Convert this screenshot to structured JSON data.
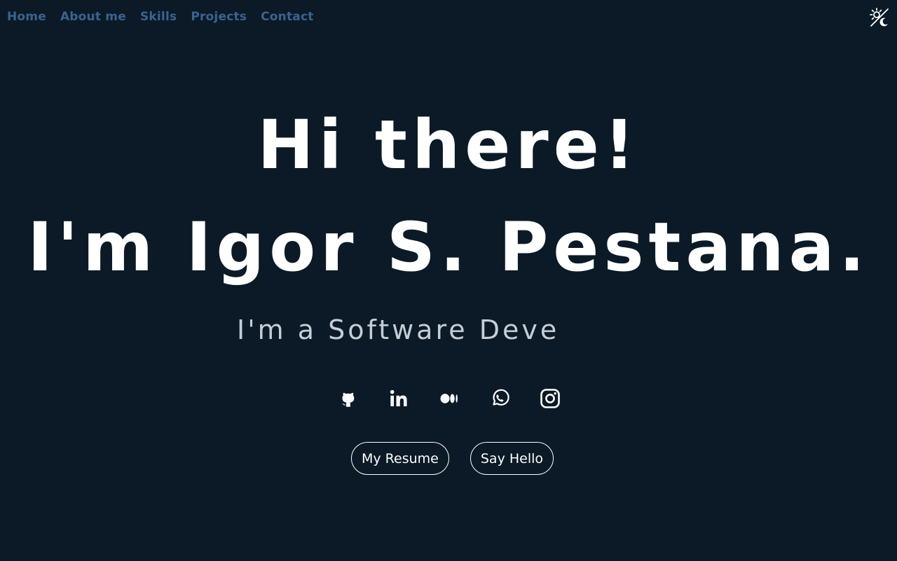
{
  "nav": {
    "items": [
      {
        "label": "Home"
      },
      {
        "label": "About me"
      },
      {
        "label": "Skills"
      },
      {
        "label": "Projects"
      },
      {
        "label": "Contact"
      }
    ],
    "color": "#3b6391"
  },
  "theme_toggle": {
    "icon": "sun-moon-icon"
  },
  "hero": {
    "line1": "Hi there!",
    "line2": "I'm Igor S. Pestana.",
    "subtitle": "I'm a Software Deve"
  },
  "socials": [
    {
      "icon": "github-icon"
    },
    {
      "icon": "linkedin-icon"
    },
    {
      "icon": "medium-icon"
    },
    {
      "icon": "whatsapp-icon"
    },
    {
      "icon": "instagram-icon"
    }
  ],
  "buttons": {
    "resume_label": "My Resume",
    "hello_label": "Say Hello"
  },
  "colors": {
    "background": "#0b1a26",
    "text": "#ffffff",
    "subtitle": "#c5cdd6"
  }
}
